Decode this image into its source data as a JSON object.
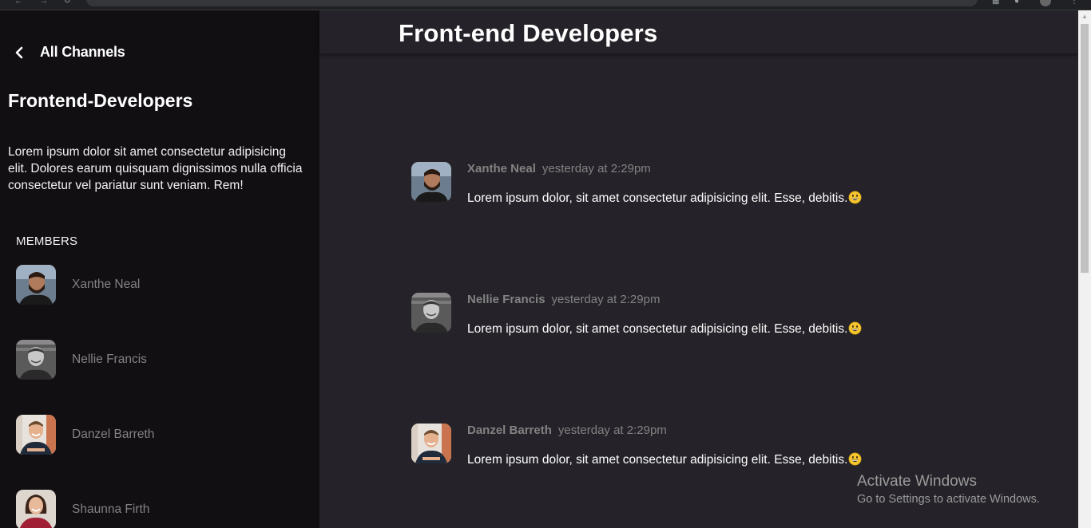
{
  "sidebar": {
    "back_label": "All Channels",
    "channel_name": "Frontend-Developers",
    "channel_description": "Lorem ipsum dolor sit amet consectetur adipisicing elit. Dolores earum quisquam dignissimos nulla officia consectetur vel pariatur sunt veniam. Rem!",
    "members_heading": "MEMBERS",
    "members": [
      {
        "name": "Xanthe Neal",
        "avatar": "avatar-man-beard"
      },
      {
        "name": "Nellie Francis",
        "avatar": "avatar-man-grayscale"
      },
      {
        "name": "Danzel Barreth",
        "avatar": "avatar-man-smiling"
      },
      {
        "name": "Shaunna Firth",
        "avatar": "avatar-woman"
      }
    ]
  },
  "main": {
    "title": "Front-end Developers",
    "messages": [
      {
        "author": "Xanthe Neal",
        "time": "yesterday at 2:29pm",
        "text": "Lorem ipsum dolor, sit amet consectetur adipisicing elit. Esse, debitis.",
        "emoji": "grinning-face-icon"
      },
      {
        "author": "Nellie Francis",
        "time": "yesterday at 2:29pm",
        "text": "Lorem ipsum dolor, sit amet consectetur adipisicing elit. Esse, debitis.",
        "emoji": "grinning-face-icon"
      },
      {
        "author": "Danzel Barreth",
        "time": "yesterday at 2:29pm",
        "text": "Lorem ipsum dolor, sit amet consectetur adipisicing elit. Esse, debitis.",
        "emoji": "grinning-face-icon"
      }
    ]
  },
  "watermark": {
    "title": "Activate Windows",
    "subtitle": "Go to Settings to activate Windows."
  },
  "colors": {
    "sidebar_bg": "#120f13",
    "main_bg": "#252329",
    "muted_text": "#828282",
    "emoji_yellow": "#f7c52e"
  }
}
